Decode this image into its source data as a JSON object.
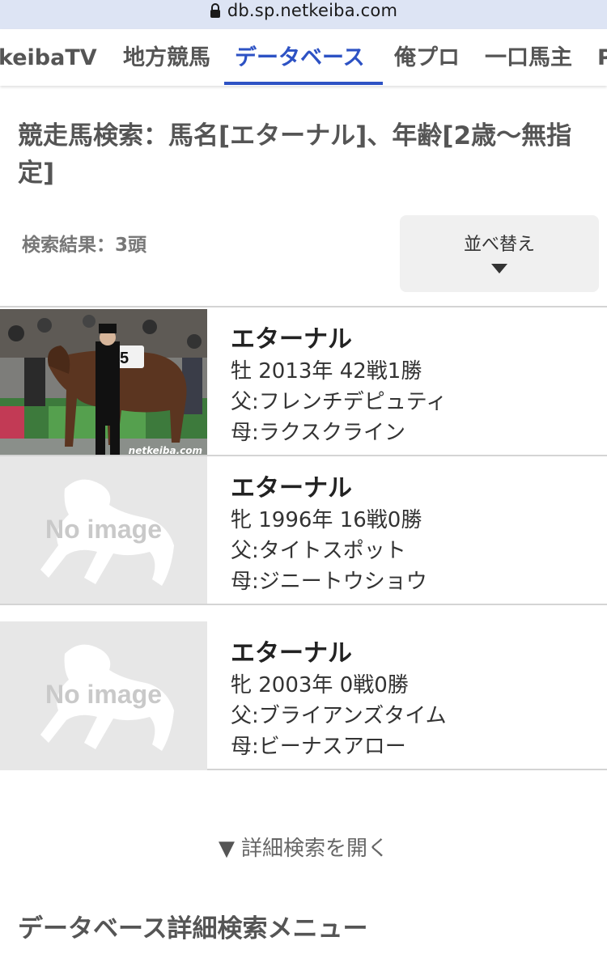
{
  "browser": {
    "url": "db.sp.netkeiba.com"
  },
  "nav": {
    "tabs": [
      {
        "label": "keibaTV"
      },
      {
        "label": "地方競馬"
      },
      {
        "label": "データベース",
        "active": true
      },
      {
        "label": "俺プロ"
      },
      {
        "label": "一口馬主"
      },
      {
        "label": "P"
      }
    ]
  },
  "search": {
    "title": "競走馬検索：馬名[エターナル]、年齢[2歳〜無指定]",
    "result_count": "検索結果：3頭",
    "sort_label": "並べ替え"
  },
  "results": [
    {
      "name": "エターナル",
      "info": "牡 2013年  42戦1勝",
      "sire": "父:フレンチデピュティ",
      "dam": "母:ラクスクライン",
      "image": "photo",
      "watermark": "netkeiba.com"
    },
    {
      "name": "エターナル",
      "info": "牝 1996年  16戦0勝",
      "sire": "父:タイトスポット",
      "dam": "母:ジニートウショウ",
      "image": "No image"
    },
    {
      "name": "エターナル",
      "info": "牝 2003年  0戦0勝",
      "sire": "父:ブライアンズタイム",
      "dam": "母:ビーナスアロー",
      "image": "No image"
    }
  ],
  "footer": {
    "detail_search": "詳細検索を開く",
    "menu_title": "データベース詳細検索メニュー"
  },
  "colors": {
    "accent": "#2d52c4",
    "urlbar": "#dde4f4"
  }
}
